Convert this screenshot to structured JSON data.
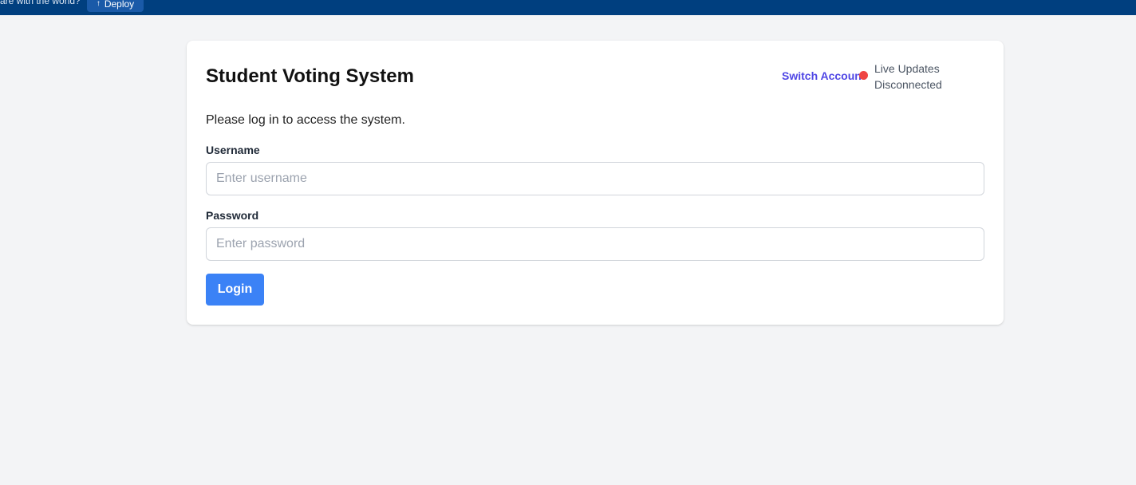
{
  "topbar": {
    "share_text": "are with the world?",
    "deploy_label": "Deploy",
    "deploy_icon": "upload-icon"
  },
  "header": {
    "title": "Student Voting System",
    "switch_account_label": "Switch Account",
    "status_line1": "Live Updates",
    "status_line2": "Disconnected",
    "status_color": "#ef4444"
  },
  "login": {
    "intro": "Please log in to access the system.",
    "username_label": "Username",
    "username_placeholder": "Enter username",
    "username_value": "",
    "password_label": "Password",
    "password_placeholder": "Enter password",
    "password_value": "",
    "submit_label": "Login"
  },
  "colors": {
    "topbar": "#003f7f",
    "accent_button": "#3b82f6",
    "link": "#4f46e5",
    "background": "#f3f4f6"
  }
}
